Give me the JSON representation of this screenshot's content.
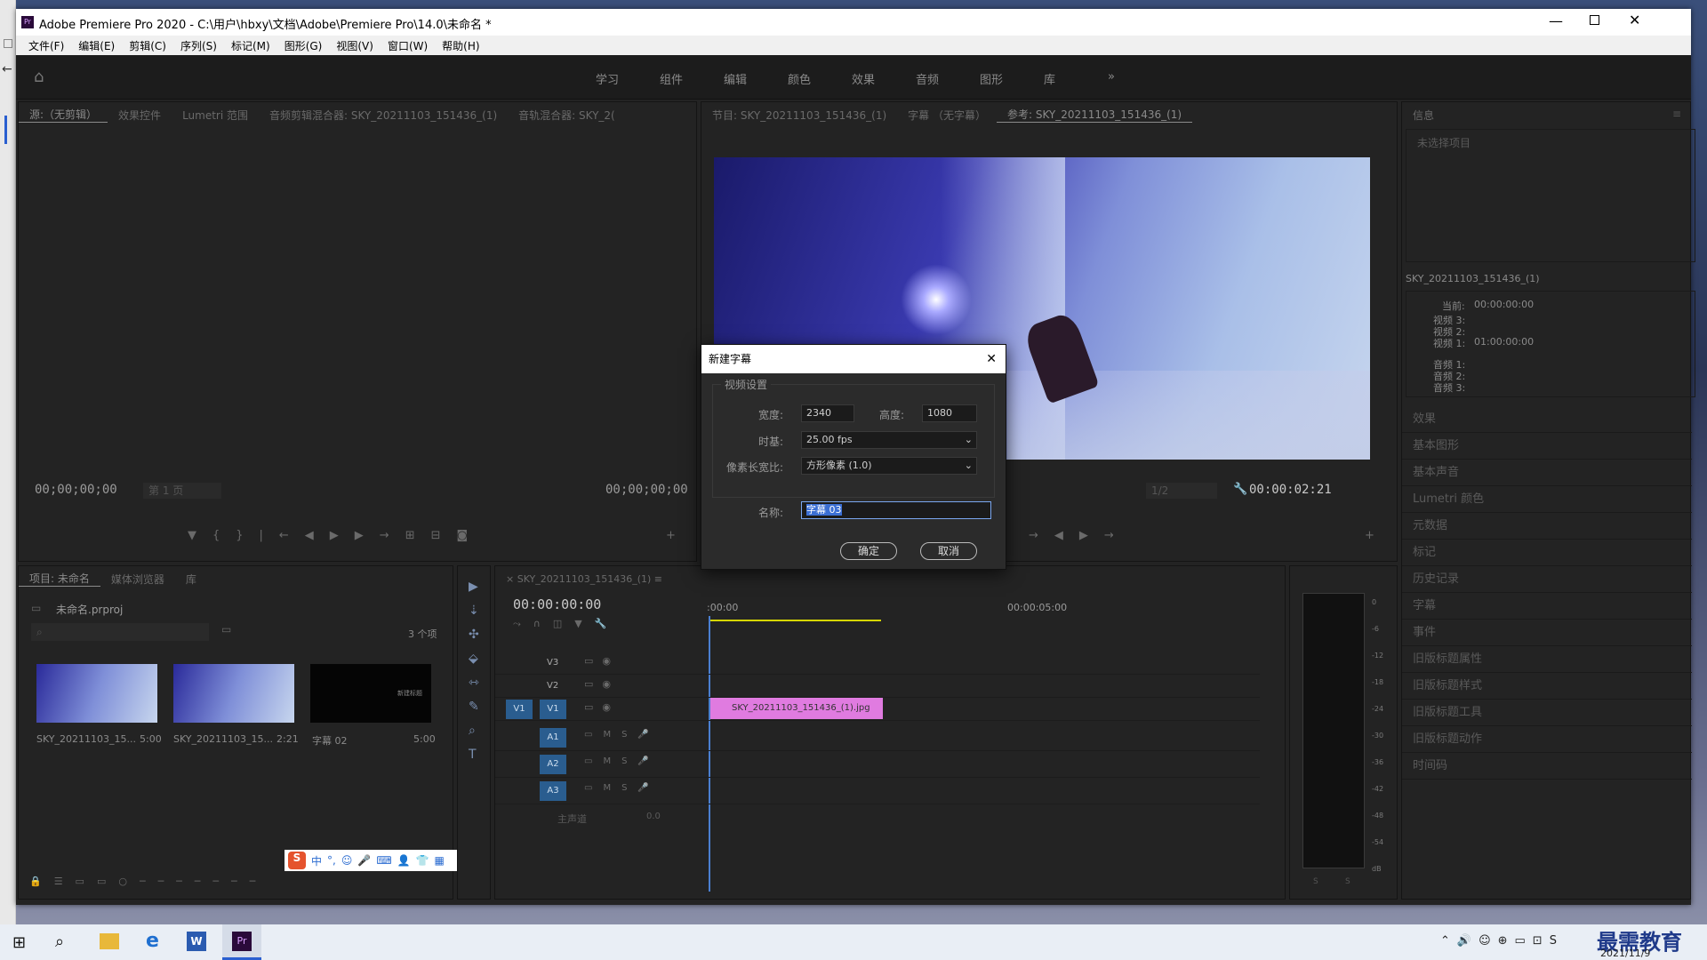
{
  "window": {
    "title": "Adobe Premiere Pro 2020 - C:\\用户\\hbxy\\文档\\Adobe\\Premiere Pro\\14.0\\未命名 *",
    "app_icon": "Pr"
  },
  "menu": [
    "文件(F)",
    "编辑(E)",
    "剪辑(C)",
    "序列(S)",
    "标记(M)",
    "图形(G)",
    "视图(V)",
    "窗口(W)",
    "帮助(H)"
  ],
  "workspaces": [
    "学习",
    "组件",
    "编辑",
    "颜色",
    "效果",
    "音频",
    "图形",
    "库"
  ],
  "source_panel": {
    "tabs": [
      "源:（无剪辑）",
      "效果控件",
      "Lumetri 范围",
      "音频剪辑混合器: SKY_20211103_151436_(1)",
      "音轨混合器: SKY_2("
    ],
    "timecode_left": "00;00;00;00",
    "page": "第 1 页",
    "timecode_right": "00;00;00;00"
  },
  "program_panel": {
    "tabs": [
      "节目: SKY_20211103_151436_(1)",
      "字幕 （无字幕）",
      "参考: SKY_20211103_151436_(1)"
    ],
    "fraction": "1/2",
    "timecode": "00:00:02:21"
  },
  "info_panel": {
    "title": "信息",
    "no_selection": "未选择项目",
    "clip_name": "SKY_20211103_151436_(1)",
    "current_label": "当前:",
    "current_value": "00:00:00:00",
    "v3": "视频 3:",
    "v2": "视频 2:",
    "v1": "视频 1:",
    "v1_value": "01:00:00:00",
    "a1": "音频 1:",
    "a2": "音频 2:",
    "a3": "音频 3:"
  },
  "right_list": [
    "效果",
    "基本图形",
    "基本声音",
    "Lumetri 颜色",
    "元数据",
    "标记",
    "历史记录",
    "字幕",
    "事件",
    "旧版标题属性",
    "旧版标题样式",
    "旧版标题工具",
    "旧版标题动作",
    "时间码"
  ],
  "project_panel": {
    "tabs": [
      "项目: 未命名",
      "媒体浏览器",
      "库"
    ],
    "file": "未命名.prproj",
    "count": "3 个项",
    "items": [
      {
        "name": "SKY_20211103_15...",
        "dur": "5:00"
      },
      {
        "name": "SKY_20211103_15...",
        "dur": "2:21"
      },
      {
        "name": "字幕 02",
        "dur": "5:00"
      }
    ],
    "thumb_text": "新建标题"
  },
  "timeline": {
    "tab": "SKY_20211103_151436_(1)",
    "timecode": "00:00:00:00",
    "ruler_start": ":00:00",
    "ruler_mid": "00:00:05:00",
    "tracks": [
      "V3",
      "V2",
      "V1",
      "A1",
      "A2",
      "A3"
    ],
    "src_v1": "V1",
    "master": "主声道",
    "master_val": "0.0",
    "clip": "SKY_20211103_151436_(1).jpg"
  },
  "meter": {
    "labels": [
      "0",
      "-6",
      "-12",
      "-18",
      "-24",
      "-30",
      "-36",
      "-42",
      "-48",
      "-54",
      "dB"
    ],
    "solo": "S"
  },
  "dialog": {
    "title": "新建字幕",
    "group": "视频设置",
    "width_label": "宽度:",
    "width": "2340",
    "height_label": "高度:",
    "height": "1080",
    "timebase_label": "时基:",
    "timebase": "25.00 fps",
    "par_label": "像素长宽比:",
    "par": "方形像素 (1.0)",
    "name_label": "名称:",
    "name": "字幕 03",
    "ok": "确定",
    "cancel": "取消"
  },
  "ime": [
    "中",
    "°,",
    "☺",
    "🎤",
    "⌨",
    "👤",
    "👕",
    "▦"
  ],
  "taskbar": {
    "date": "2021/11/9",
    "watermark": "最需教育"
  },
  "colors": {
    "accent": "#4a7fd0",
    "clip": "#e07be0",
    "track_btn": "#2a5d8f"
  }
}
